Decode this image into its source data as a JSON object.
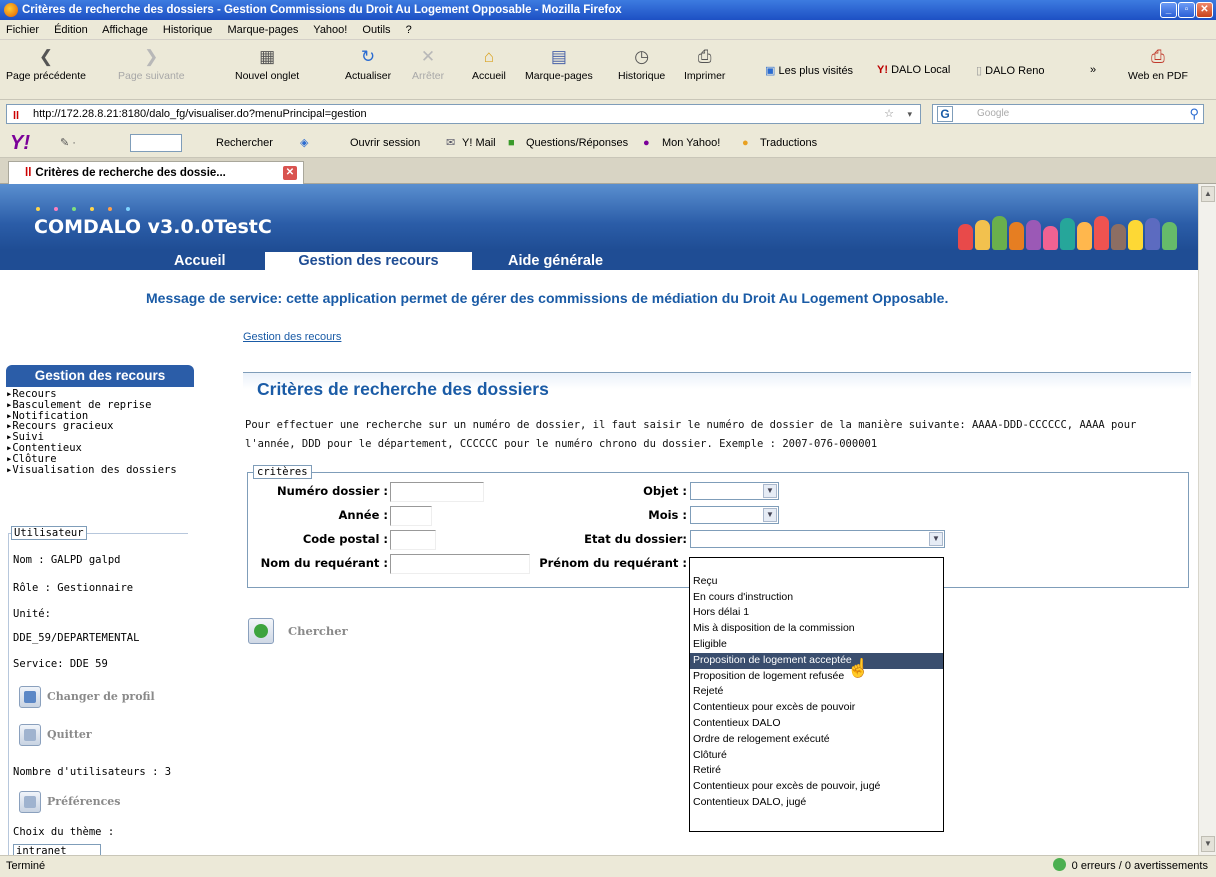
{
  "window": {
    "title": "Critères de recherche des dossiers - Gestion Commissions du Droit Au Logement Opposable - Mozilla Firefox"
  },
  "menu": [
    "Fichier",
    "Édition",
    "Affichage",
    "Historique",
    "Marque-pages",
    "Yahoo!",
    "Outils",
    "?"
  ],
  "nav": {
    "back": "Page précédente",
    "forward": "Page suivante",
    "new_tab": "Nouvel onglet",
    "reload": "Actualiser",
    "stop": "Arrêter",
    "home": "Accueil",
    "bookmarks": "Marque-pages",
    "history": "Historique",
    "print": "Imprimer",
    "most_visited": "Les plus visités",
    "dalo_local": "DALO Local",
    "dalo_reno": "DALO Reno",
    "chevron": "»",
    "pdf": "Web en PDF"
  },
  "url": {
    "value": "http://172.28.8.21:8180/dalo_fg/visualiser.do?menuPrincipal=gestion",
    "search_placeholder": "Google"
  },
  "yahoo_bar": {
    "search": "Rechercher",
    "open_session": "Ouvrir session",
    "mail": "Y! Mail",
    "qa": "Questions/Réponses",
    "my_yahoo": "Mon Yahoo!",
    "translations": "Traductions"
  },
  "tab": {
    "label": "Critères de recherche des dossie..."
  },
  "app": {
    "name": "COMDALO v3.0.0TestC",
    "nav": [
      "Accueil",
      "Gestion des recours",
      "Aide générale"
    ],
    "service_message": "Message de service: cette application permet de gérer des commissions de médiation du Droit Au Logement Opposable.",
    "breadcrumb": "Gestion des recours"
  },
  "sidebar": {
    "title": "Gestion des recours",
    "items": [
      "Recours",
      "Basculement de reprise",
      "Notification",
      "Recours gracieux",
      "Suivi",
      "Contentieux",
      "Clôture",
      "Visualisation des dossiers"
    ],
    "user": {
      "legend": "Utilisateur",
      "name": "Nom : GALPD galpd",
      "role": "Rôle : Gestionnaire",
      "unit_label": "Unité:",
      "unit_value": "DDE_59/DEPARTEMENTAL",
      "service": "Service: DDE 59",
      "change_profile": "Changer de profil",
      "quit": "Quitter",
      "user_count": "Nombre d'utilisateurs : 3",
      "preferences": "Préférences",
      "theme_label": "Choix du thème :",
      "theme_value": "intranet"
    }
  },
  "main": {
    "title": "Critères de recherche des dossiers",
    "intro": "Pour effectuer une recherche sur un numéro de dossier, il faut saisir le numéro de dossier de la manière suivante: AAAA-DDD-CCCCCC, AAAA pour l'année, DDD pour le département, CCCCCC pour le numéro chrono du dossier. Exemple : 2007-076-000001",
    "legend": "critères",
    "fields": {
      "numero": "Numéro dossier :",
      "annee": "Année :",
      "code_postal": "Code postal :",
      "nom": "Nom du requérant :",
      "objet": "Objet :",
      "mois": "Mois :",
      "etat": "Etat du dossier:",
      "prenom": "Prénom du requérant :"
    },
    "search_button": "Chercher"
  },
  "dropdown": {
    "options": [
      "",
      "Reçu",
      "En cours d'instruction",
      "Hors délai 1",
      "Mis à disposition de la commission",
      "Eligible",
      "Proposition de logement acceptée",
      "Proposition de logement refusée",
      "Rejeté",
      "Contentieux pour excès de pouvoir",
      "Contentieux DALO",
      "Ordre de relogement exécuté",
      "Clôturé",
      "Retiré",
      "Contentieux pour excès de pouvoir, jugé",
      "Contentieux DALO, jugé"
    ],
    "highlighted": "Proposition de logement acceptée"
  },
  "status": {
    "left": "Terminé",
    "right": "0 erreurs / 0 avertissements"
  }
}
